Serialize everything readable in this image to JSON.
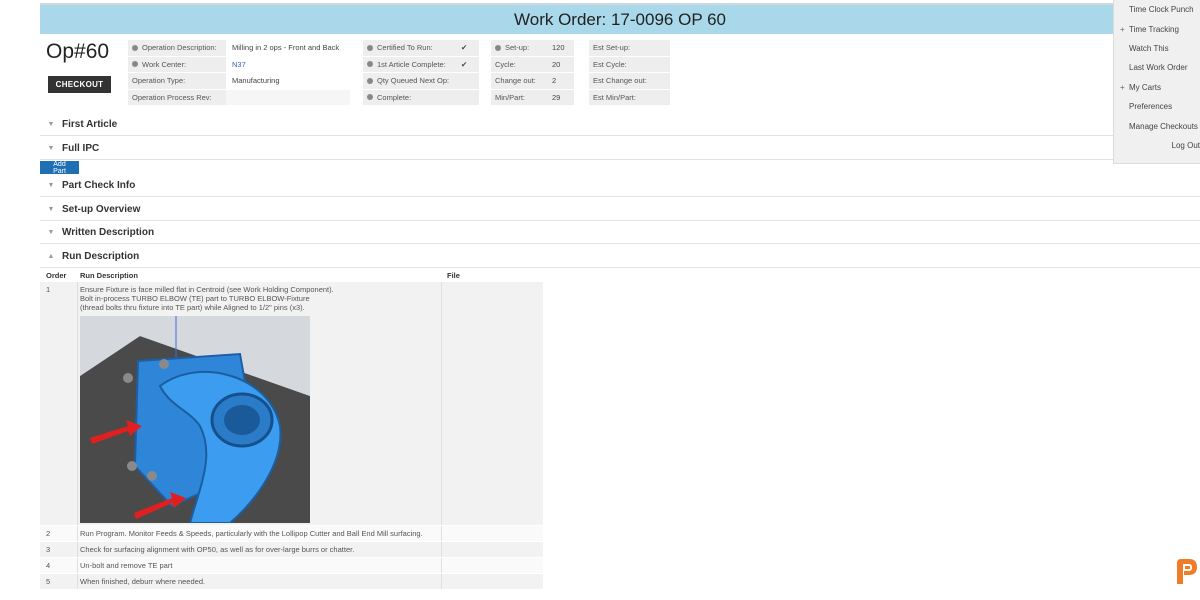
{
  "header": {
    "title": "Work Order: 17-0096 OP 60"
  },
  "op": {
    "title": "Op#60",
    "checkout_label": "CHECKOUT"
  },
  "details": {
    "col1": [
      {
        "label": "Operation Description:",
        "value": "Milling in 2 ops - Front and Back",
        "dot": true
      },
      {
        "label": "Work Center:",
        "value": "N37",
        "dot": true,
        "link": true
      },
      {
        "label": "Operation Type:",
        "value": "Manufacturing",
        "dot": false
      },
      {
        "label": "Operation Process Rev:",
        "value": "",
        "dot": false
      }
    ],
    "col2": [
      {
        "label": "Certified To Run:",
        "value": "✔",
        "dot": true
      },
      {
        "label": "1st Article Complete:",
        "value": "✔",
        "dot": true
      },
      {
        "label": "Qty Queued Next Op:",
        "value": "",
        "dot": true
      },
      {
        "label": "Complete:",
        "value": "",
        "dot": true
      }
    ],
    "col3": [
      {
        "label": "Set-up:",
        "value": "120",
        "dot": true
      },
      {
        "label": "Cycle:",
        "value": "20",
        "dot": false
      },
      {
        "label": "Change out:",
        "value": "2",
        "dot": false
      },
      {
        "label": "Min/Part:",
        "value": "29",
        "dot": false
      }
    ],
    "col4": [
      {
        "label": "Est Set-up:",
        "value": ""
      },
      {
        "label": "Est Cycle:",
        "value": ""
      },
      {
        "label": "Est Change out:",
        "value": ""
      },
      {
        "label": "Est Min/Part:",
        "value": ""
      }
    ]
  },
  "sections": {
    "first_article": "First Article",
    "full_ipc": "Full IPC",
    "add_part": "Add Part",
    "part_check": "Part Check Info",
    "setup_overview": "Set-up Overview",
    "written_desc": "Written Description",
    "run_desc": "Run Description"
  },
  "run_table": {
    "headers": {
      "order": "Order",
      "desc": "Run Description",
      "file": "File"
    },
    "row1": {
      "order": "1",
      "line1": "Ensure Fixture is face milled flat in Centroid (see Work Holding Component).",
      "line2": "Bolt in-process TURBO ELBOW (TE) part to TURBO ELBOW-Fixture",
      "line3": "(thread bolts thru fixture into TE part) while Aligned to 1/2\" pins (x3)."
    },
    "rows": [
      {
        "order": "2",
        "desc": "Run Program. Monitor Feeds & Speeds, particularly with the Lollipop Cutter and Ball End Mill surfacing."
      },
      {
        "order": "3",
        "desc": "Check for surfacing alignment with OP50, as well as for over-large burrs or chatter."
      },
      {
        "order": "4",
        "desc": "Un-bolt and remove TE part"
      },
      {
        "order": "5",
        "desc": "When finished, deburr where needed."
      }
    ]
  },
  "menu": {
    "time_clock": "Time Clock Punch",
    "time_tracking": "Time Tracking",
    "watch": "Watch This",
    "last_wo": "Last Work Order",
    "carts": "My Carts",
    "prefs": "Preferences",
    "manage": "Manage Checkouts",
    "logout": "Log Out",
    "plus": "+"
  },
  "colors": {
    "header_bg": "#a8d8ea",
    "button_dark": "#333333",
    "button_blue": "#1f6fb5",
    "logo": "#f07c28"
  }
}
